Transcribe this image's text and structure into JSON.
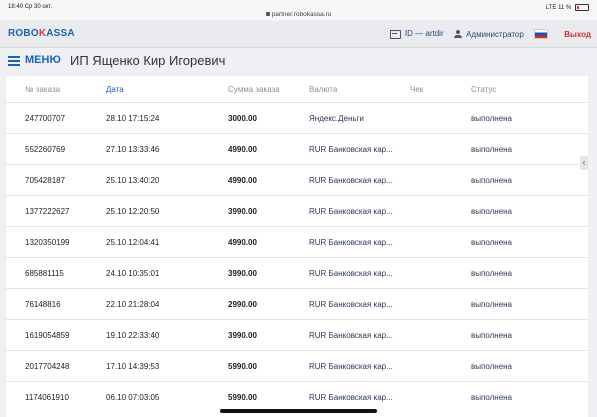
{
  "status_bar": {
    "time": "18:40",
    "date": "Ср 30 окт.",
    "url": "partner.robokassa.ru",
    "network": "LTE",
    "battery": "11 %"
  },
  "header": {
    "logo_part1": "ROBO",
    "logo_part2": "K",
    "logo_part3": "ASSA",
    "id_label": "ID",
    "id_dash": "—",
    "id_value": "artdir",
    "user": "Администратор",
    "logout": "Выход"
  },
  "nav": {
    "menu_label": "МЕНЮ",
    "page_title": "ИП Ященко Кир Игоревич"
  },
  "table": {
    "columns": [
      "№ заказа",
      "Дата",
      "Сумма заказа",
      "Валюта",
      "Чек",
      "Статус"
    ],
    "rows": [
      {
        "order": "247700707",
        "date": "28.10 17:15:24",
        "sum": "3000.00",
        "currency": "Яндекс.Деньги",
        "check": "",
        "status": "выполнена"
      },
      {
        "order": "552260769",
        "date": "27.10 13:33:46",
        "sum": "4990.00",
        "currency": "RUR Банковская кар...",
        "check": "",
        "status": "выполнена"
      },
      {
        "order": "705428187",
        "date": "25.10 13:40:20",
        "sum": "4990.00",
        "currency": "RUR Банковская кар...",
        "check": "",
        "status": "выполнена"
      },
      {
        "order": "1377222627",
        "date": "25.10 12:20:50",
        "sum": "3990.00",
        "currency": "RUR Банковская кар...",
        "check": "",
        "status": "выполнена"
      },
      {
        "order": "1320350199",
        "date": "25.10 12:04:41",
        "sum": "4990.00",
        "currency": "RUR Банковская кар...",
        "check": "",
        "status": "выполнена"
      },
      {
        "order": "685881115",
        "date": "24.10 10:35:01",
        "sum": "3990.00",
        "currency": "RUR Банковская кар...",
        "check": "",
        "status": "выполнена"
      },
      {
        "order": "76148816",
        "date": "22.10 21:28:04",
        "sum": "2990.00",
        "currency": "RUR Банковская кар...",
        "check": "",
        "status": "выполнена"
      },
      {
        "order": "1619054859",
        "date": "19.10 22:33:40",
        "sum": "3990.00",
        "currency": "RUR Банковская кар...",
        "check": "",
        "status": "выполнена"
      },
      {
        "order": "2017704248",
        "date": "17.10 14:39:53",
        "sum": "5990.00",
        "currency": "RUR Банковская кар...",
        "check": "",
        "status": "выполнена"
      },
      {
        "order": "1174061910",
        "date": "06.10 07:03:05",
        "sum": "5990.00",
        "currency": "RUR Банковская кар...",
        "check": "",
        "status": "выполнена"
      }
    ]
  },
  "icons": {
    "id": "id-card-icon",
    "user": "user-icon",
    "flag": "russian-flag-icon",
    "menu": "hamburger-menu-icon",
    "collapse": "chevron-left-icon"
  },
  "colors": {
    "brand_blue": "#1b63b8",
    "brand_red": "#e53935",
    "logout": "#d32f2f"
  }
}
